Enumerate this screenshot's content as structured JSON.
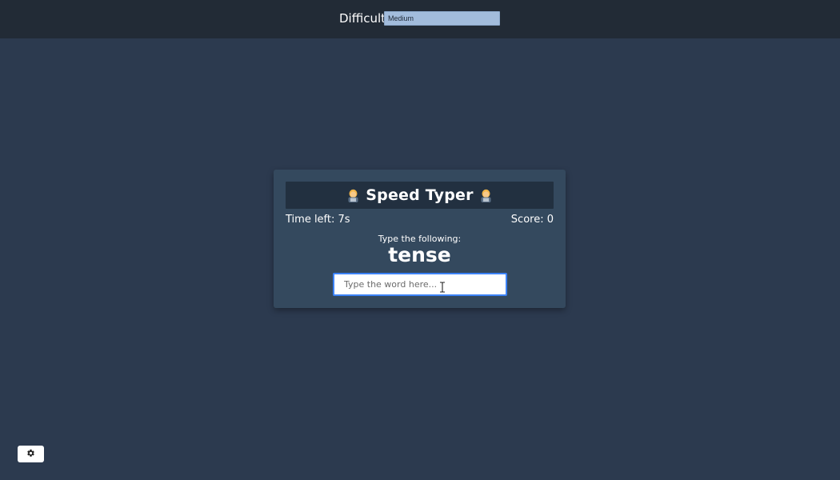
{
  "header": {
    "difficulty_label": "Difficulty",
    "difficulty_selected": "Medium"
  },
  "game": {
    "title": "Speed Typer",
    "title_icon": "technologist-emoji",
    "time_left": "Time left: 7s",
    "score": "Score: 0",
    "prompt_label": "Type the following:",
    "target_word": "tense",
    "input_value": "",
    "input_placeholder": "Type the word here..."
  },
  "settings": {
    "icon": "gear-icon"
  },
  "colors": {
    "page_bg": "#2c3a4f",
    "topbar_bg": "#222b36",
    "card_bg": "#34495e",
    "title_bg": "#223040",
    "select_bg": "#a2bcdc",
    "input_border": "#3b82f6"
  }
}
